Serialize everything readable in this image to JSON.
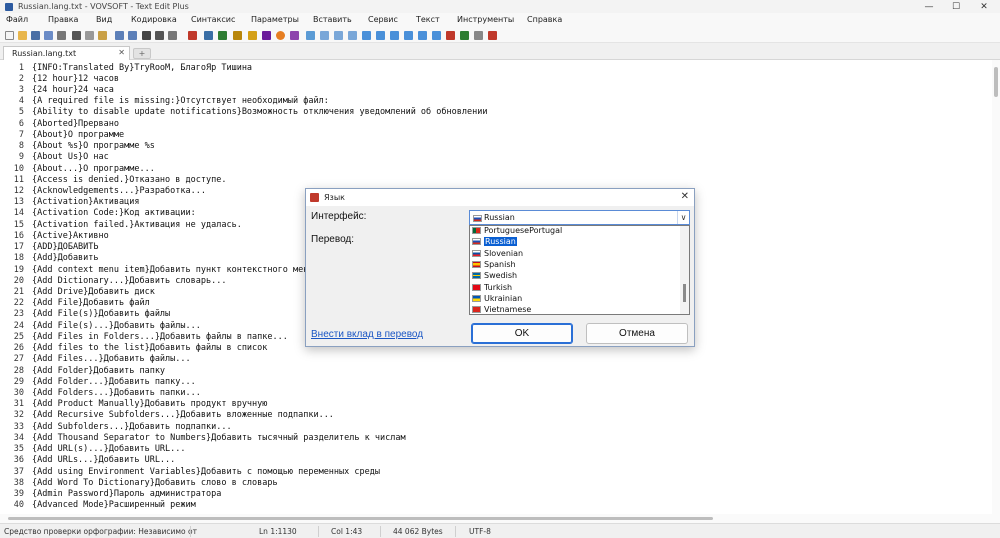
{
  "window": {
    "title": "Russian.lang.txt - VOVSOFT - Text Edit Plus",
    "controls": {
      "minimize": "—",
      "maximize": "☐",
      "close": "✕"
    }
  },
  "menu": [
    "Файл",
    "Правка",
    "Вид",
    "Кодировка",
    "Синтаксис",
    "Параметры",
    "Вставить",
    "Сервис",
    "Текст",
    "Инструменты",
    "Справка"
  ],
  "tabs": [
    {
      "label": "Russian.lang.txt",
      "close": "✕"
    }
  ],
  "newtab_glyph": "+",
  "editor": {
    "lines": [
      {
        "n": "1",
        "t": "{INFO:Translated By}TryRooM, БлагоЯр Тишина"
      },
      {
        "n": "2",
        "t": "{12 hour}12 часов"
      },
      {
        "n": "3",
        "t": "{24 hour}24 часа"
      },
      {
        "n": "4",
        "t": "{A required file is missing:}Отсутствует необходимый файл:"
      },
      {
        "n": "5",
        "t": "{Ability to disable update notifications}Возможность отключения уведомлений об обновлении"
      },
      {
        "n": "6",
        "t": "{Aborted}Прервано"
      },
      {
        "n": "7",
        "t": "{About}О программе"
      },
      {
        "n": "8",
        "t": "{About %s}О программе %s"
      },
      {
        "n": "9",
        "t": "{About Us}О нас"
      },
      {
        "n": "10",
        "t": "{About...}О программе..."
      },
      {
        "n": "11",
        "t": "{Access is denied.}Отказано в доступе."
      },
      {
        "n": "12",
        "t": "{Acknowledgements...}Разработка..."
      },
      {
        "n": "13",
        "t": "{Activation}Активация"
      },
      {
        "n": "14",
        "t": "{Activation Code:}Код активации:"
      },
      {
        "n": "15",
        "t": "{Activation failed.}Активация не удалась."
      },
      {
        "n": "16",
        "t": "{Active}Активно"
      },
      {
        "n": "17",
        "t": "{ADD}ДОБАВИТЬ"
      },
      {
        "n": "18",
        "t": "{Add}Добавить"
      },
      {
        "n": "19",
        "t": "{Add context menu item}Добавить пункт контекстного меню"
      },
      {
        "n": "20",
        "t": "{Add Dictionary...}Добавить словарь..."
      },
      {
        "n": "21",
        "t": "{Add Drive}Добавить диск"
      },
      {
        "n": "22",
        "t": "{Add File}Добавить файл"
      },
      {
        "n": "23",
        "t": "{Add File(s)}Добавить файлы"
      },
      {
        "n": "24",
        "t": "{Add File(s)...}Добавить файлы..."
      },
      {
        "n": "25",
        "t": "{Add Files in Folders...}Добавить файлы в папке..."
      },
      {
        "n": "26",
        "t": "{Add files to the list}Добавить файлы в список"
      },
      {
        "n": "27",
        "t": "{Add Files...}Добавить файлы..."
      },
      {
        "n": "28",
        "t": "{Add Folder}Добавить папку"
      },
      {
        "n": "29",
        "t": "{Add Folder...}Добавить папку..."
      },
      {
        "n": "30",
        "t": "{Add Folders...}Добавить папки..."
      },
      {
        "n": "31",
        "t": "{Add Product Manually}Добавить продукт вручную"
      },
      {
        "n": "32",
        "t": "{Add Recursive Subfolders...}Добавить вложенные подпапки..."
      },
      {
        "n": "33",
        "t": "{Add Subfolders...}Добавить подпапки..."
      },
      {
        "n": "34",
        "t": "{Add Thousand Separator to Numbers}Добавить тысячный разделитель к числам"
      },
      {
        "n": "35",
        "t": "{Add URL(s)...}Добавить URL..."
      },
      {
        "n": "36",
        "t": "{Add URLs...}Добавить URL..."
      },
      {
        "n": "37",
        "t": "{Add using Environment Variables}Добавить с помощью переменных среды"
      },
      {
        "n": "38",
        "t": "{Add Word To Dictionary}Добавить слово в словарь"
      },
      {
        "n": "39",
        "t": "{Admin Password}Пароль администратора"
      },
      {
        "n": "40",
        "t": "{Advanced Mode}Расширенный режим"
      }
    ]
  },
  "status": {
    "spellcheck": "Средство проверки орфографии: Независимо от",
    "position": "Ln 1:1130",
    "column": "Col 1:43",
    "size": "44 062 Bytes",
    "encoding": "UTF-8"
  },
  "dialog": {
    "title": "Язык",
    "close": "✕",
    "interface_label": "Интерфейс:",
    "translation_label": "Перевод:",
    "selected_language": "Russian",
    "arrow": "∨",
    "options": [
      {
        "label": "PortuguesePortugal",
        "flag": "pt"
      },
      {
        "label": "Russian",
        "flag": "ru",
        "selected": true
      },
      {
        "label": "Slovenian",
        "flag": "si"
      },
      {
        "label": "Spanish",
        "flag": "es"
      },
      {
        "label": "Swedish",
        "flag": "se"
      },
      {
        "label": "Turkish",
        "flag": "tr"
      },
      {
        "label": "Ukrainian",
        "flag": "ua"
      },
      {
        "label": "Vietnamese",
        "flag": "vn"
      }
    ],
    "contribute_link": "Внести вклад в перевод",
    "ok": "OK",
    "cancel": "Отмена"
  },
  "colors": {
    "accent": "#0a5fd2",
    "link": "#1a56c4",
    "dialog_border": "#8aa0c0"
  }
}
